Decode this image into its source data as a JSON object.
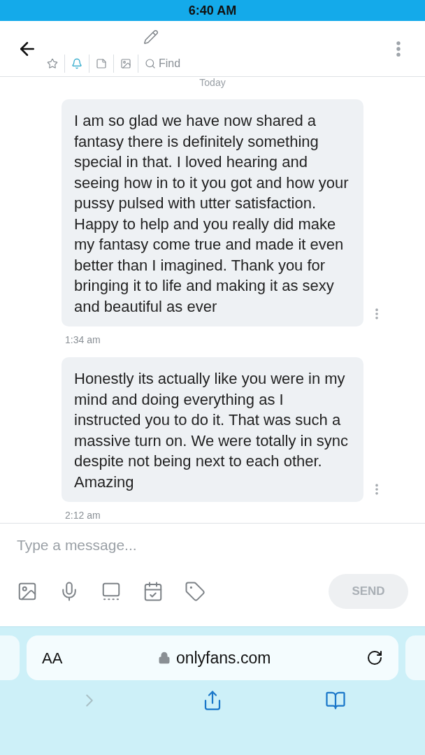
{
  "status_bar": {
    "time": "6:40 AM"
  },
  "toolbar": {
    "items": [
      {
        "kind": "star",
        "selected": false
      },
      {
        "kind": "bell",
        "selected": true
      },
      {
        "kind": "note",
        "selected": false
      },
      {
        "kind": "image",
        "selected": false
      },
      {
        "kind": "find",
        "label": "Find",
        "selected": false
      }
    ]
  },
  "day_label": "Today",
  "messages": [
    {
      "text": "I am so glad we have now shared a fantasy there is definitely something special in that. I loved hearing and seeing how in to it you got and how your pussy pulsed with utter satisfaction. Happy to help and you really did make my fantasy come true and made it even better than I imagined. Thank you for bringing it to life and making it as sexy and beautiful as ever",
      "time": "1:34 am"
    },
    {
      "text": "Honestly its actually like you were in my mind and doing everything as I instructed you to do it. That was such a massive turn on. We were totally in sync despite not being next to each other. Amazing",
      "time": "2:12 am"
    }
  ],
  "composer": {
    "placeholder": "Type a message...",
    "send": {
      "label": "SEND",
      "disabled": true
    }
  },
  "browser": {
    "text_size": "AA",
    "address": "onlyfans.com"
  }
}
